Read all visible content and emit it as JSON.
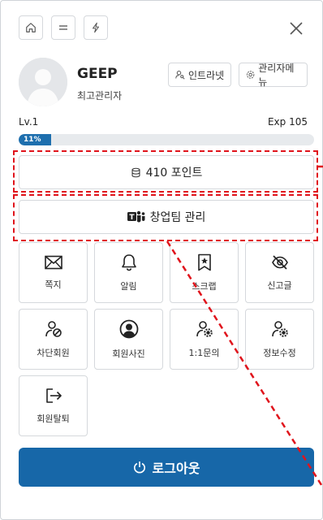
{
  "topbar": {
    "icons": [
      "home-icon",
      "menu-icon",
      "lightning-icon"
    ],
    "close_icon": "close-icon"
  },
  "profile": {
    "name": "GEEP",
    "role": "최고관리자",
    "intranet_label": "인트라넷",
    "admin_menu_label": "관리자메뉴"
  },
  "level": {
    "lv_label": "Lv.1",
    "exp_label": "Exp 105",
    "progress_text": "11%",
    "progress_fraction": 0.11
  },
  "points_button": {
    "label": "410 포인트",
    "icon": "database-icon"
  },
  "team_button": {
    "label": "창업팀 관리",
    "icon": "teams-icon"
  },
  "tiles": [
    {
      "label": "쪽지",
      "icon": "envelope-icon"
    },
    {
      "label": "알림",
      "icon": "bell-icon"
    },
    {
      "label": "스크랩",
      "icon": "bookmark-star-icon"
    },
    {
      "label": "신고글",
      "icon": "eye-slash-icon"
    },
    {
      "label": "차단회원",
      "icon": "user-block-icon"
    },
    {
      "label": "회원사진",
      "icon": "user-circle-icon"
    },
    {
      "label": "1:1문의",
      "icon": "user-gear-icon"
    },
    {
      "label": "정보수정",
      "icon": "user-gear-icon"
    },
    {
      "label": "회원탈퇴",
      "icon": "exit-icon"
    }
  ],
  "logout": {
    "label": "로그아웃",
    "icon": "power-icon"
  },
  "colors": {
    "accent": "#1767a8",
    "annotation": "#e0141c",
    "progress": "#1e6fae"
  }
}
